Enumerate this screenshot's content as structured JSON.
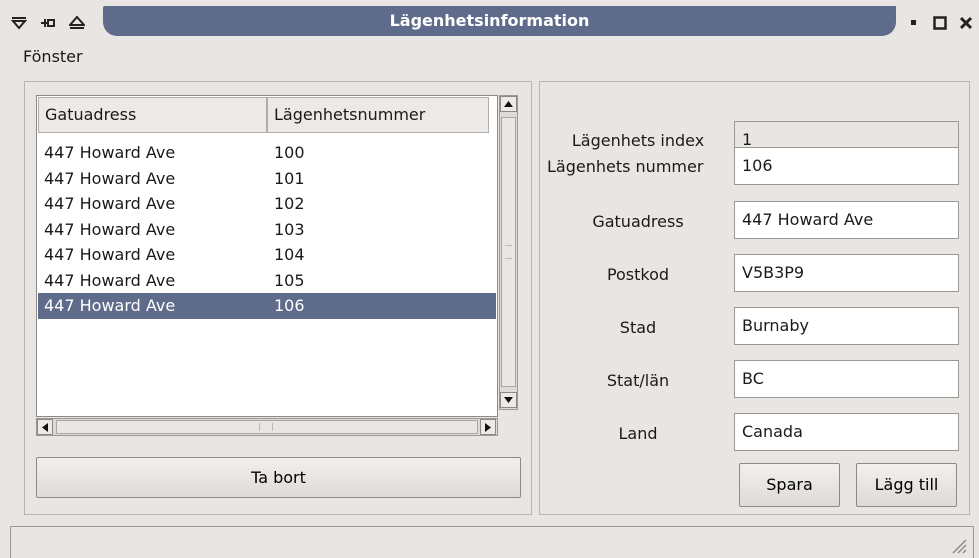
{
  "window": {
    "title": "Lägenhetsinformation",
    "title_bar_color": "#5f6b8b",
    "left_icons": [
      "shade-down-icon",
      "pin-icon",
      "eject-icon"
    ],
    "right_icons": [
      "minimize-icon",
      "maximize-icon",
      "close-icon"
    ]
  },
  "menu": {
    "items": [
      "Fönster"
    ]
  },
  "table": {
    "columns": [
      "Gatuadress",
      "Lägenhetsnummer"
    ],
    "rows": [
      [
        "447 Howard Ave",
        "100"
      ],
      [
        "447 Howard Ave",
        "101"
      ],
      [
        "447 Howard Ave",
        "102"
      ],
      [
        "447 Howard Ave",
        "103"
      ],
      [
        "447 Howard Ave",
        "104"
      ],
      [
        "447 Howard Ave",
        "105"
      ],
      [
        "447 Howard Ave",
        "106"
      ]
    ],
    "selected_row": 6,
    "selection_color": "#5f6b8b"
  },
  "buttons": {
    "delete": "Ta bort",
    "save": "Spara",
    "add": "Lägg till"
  },
  "form": {
    "index": {
      "label": "Lägenhets index",
      "value": "1"
    },
    "number": {
      "label": "Lägenhets nummer",
      "value": "106"
    },
    "street": {
      "label": "Gatuadress",
      "value": "447 Howard Ave"
    },
    "postcode": {
      "label": "Postkod",
      "value": "V5B3P9"
    },
    "city": {
      "label": "Stad",
      "value": "Burnaby"
    },
    "state": {
      "label": "Stat/län",
      "value": "BC"
    },
    "country": {
      "label": "Land",
      "value": "Canada"
    }
  }
}
